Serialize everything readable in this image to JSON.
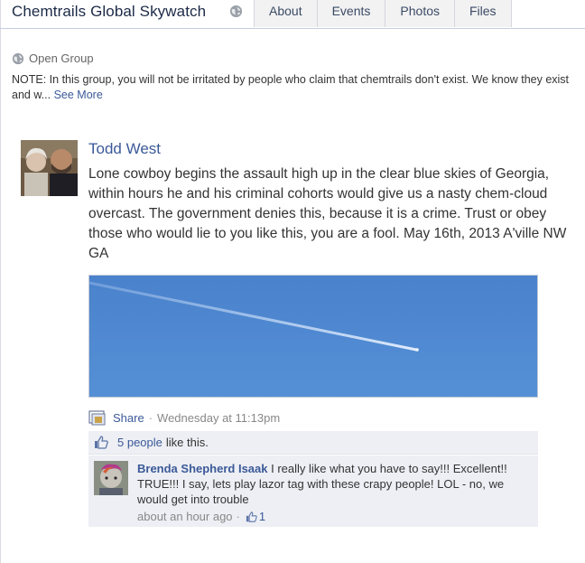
{
  "group": {
    "title": "Chemtrails Global Skywatch",
    "privacy": "Open Group",
    "note_text": "NOTE: In this group, you will not be irritated by people who claim that chemtrails don't exist. We know they exist and w...",
    "see_more": "See More"
  },
  "tabs": [
    "About",
    "Events",
    "Photos",
    "Files"
  ],
  "post": {
    "author": "Todd West",
    "text": "Lone cowboy begins the assault high up in the clear blue skies of Georgia, within hours he and his criminal cohorts would give us a nasty chem-cloud overcast. The government denies this, because it is a crime. Trust or obey those who would lie to you like this, you are a fool. May 16th, 2013 A'ville NW GA",
    "share_label": "Share",
    "separator": "·",
    "timestamp": "Wednesday at 11:13pm"
  },
  "likes": {
    "people": "5 people",
    "rest": "like this."
  },
  "comment": {
    "author": "Brenda Shepherd Isaak",
    "text": "I really like what you have to say!!! Excellent!! TRUE!!! I say, lets play lazor tag with these crapy people! LOL - no, we would get into trouble",
    "time": "about an hour ago",
    "separator": "·",
    "like_count": "1"
  },
  "colors": {
    "link": "#3b5998",
    "sky": "#4c86cf",
    "panel": "#edeff4"
  },
  "icons": [
    "globe-icon",
    "share-icon",
    "thumbs-up-icon"
  ]
}
